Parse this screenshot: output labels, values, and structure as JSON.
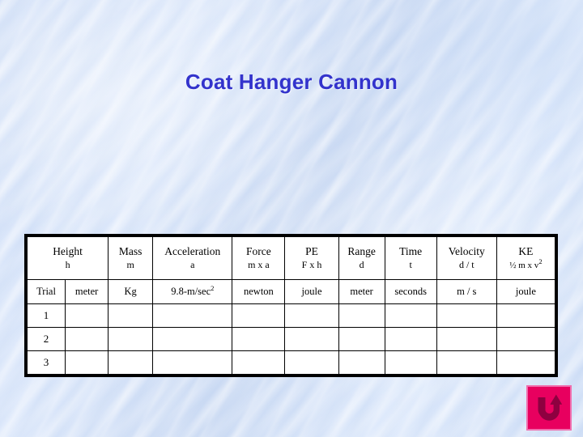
{
  "slide": {
    "title": "Coat Hanger Cannon",
    "title_color": "#3333CC",
    "background_color": "#CCDCF5"
  },
  "table": {
    "header_row": [
      {
        "name": "Height",
        "symbol": "h"
      },
      {
        "name": "Mass",
        "symbol": "m"
      },
      {
        "name": "Acceleration",
        "symbol": "a"
      },
      {
        "name": "Force",
        "symbol": "m x a"
      },
      {
        "name": "PE",
        "symbol": "F x h"
      },
      {
        "name": "Range",
        "symbol": "d"
      },
      {
        "name": "Time",
        "symbol": "t"
      },
      {
        "name": "Velocity",
        "symbol": "d / t"
      },
      {
        "name": "KE",
        "symbol_prefix": "½ m x v",
        "symbol_sup": "2"
      }
    ],
    "units_row": {
      "trial_label": "Trial",
      "height_unit": "meter",
      "mass_unit": "Kg",
      "acceleration_unit_prefix": "9.8-m/sec",
      "acceleration_unit_sup": "2",
      "force_unit": "newton",
      "pe_unit": "joule",
      "range_unit": "meter",
      "time_unit": "seconds",
      "velocity_unit": "m / s",
      "ke_unit": "joule"
    },
    "data_rows": [
      {
        "trial": "1",
        "height": "",
        "mass": "",
        "acceleration": "",
        "force": "",
        "pe": "",
        "range": "",
        "time": "",
        "velocity": "",
        "ke": ""
      },
      {
        "trial": "2",
        "height": "",
        "mass": "",
        "acceleration": "",
        "force": "",
        "pe": "",
        "range": "",
        "time": "",
        "velocity": "",
        "ke": ""
      },
      {
        "trial": "3",
        "height": "",
        "mass": "",
        "acceleration": "",
        "force": "",
        "pe": "",
        "range": "",
        "time": "",
        "velocity": "",
        "ke": ""
      }
    ]
  },
  "return_icon": {
    "icon": "u-turn-arrow-icon",
    "background_color": "#E8005F",
    "arrow_color": "#8E0040",
    "border_color": "#F06FAE"
  }
}
